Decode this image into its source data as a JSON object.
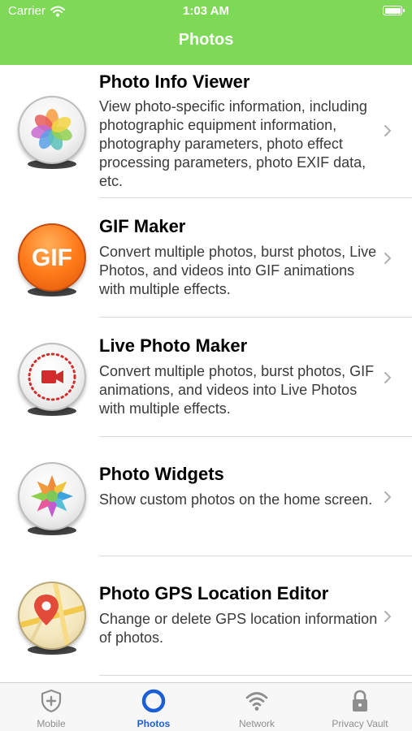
{
  "status_bar": {
    "carrier": "Carrier",
    "time": "1:03 AM"
  },
  "nav": {
    "title": "Photos"
  },
  "colors": {
    "header": "#7ed957",
    "accent": "#1a5fd6",
    "tab_inactive": "#8e8e8e"
  },
  "items": [
    {
      "title": "Photo Info Viewer",
      "description": "View photo-specific information, including photographic equipment information, photography parameters, photo effect processing parameters, photo EXIF data, etc.",
      "icon": "flower-petals-icon"
    },
    {
      "title": "GIF Maker",
      "description": "Convert multiple photos, burst photos, Live Photos, and videos into GIF animations with multiple effects.",
      "icon": "gif-icon",
      "icon_text": "GIF"
    },
    {
      "title": "Live Photo Maker",
      "description": "Convert multiple photos, burst photos, GIF animations, and videos into Live Photos with multiple effects.",
      "icon": "live-photo-camera-icon"
    },
    {
      "title": "Photo Widgets",
      "description": "Show custom photos on the home screen.",
      "icon": "widget-flower-icon"
    },
    {
      "title": "Photo GPS Location Editor",
      "description": "Change or delete GPS location information of photos.",
      "icon": "map-pin-icon"
    }
  ],
  "tabs": [
    {
      "label": "Mobile",
      "icon": "shield-plus-icon",
      "active": false
    },
    {
      "label": "Photos",
      "icon": "circle-icon",
      "active": true
    },
    {
      "label": "Network",
      "icon": "wifi-icon",
      "active": false
    },
    {
      "label": "Privacy Vault",
      "icon": "lock-icon",
      "active": false
    }
  ]
}
